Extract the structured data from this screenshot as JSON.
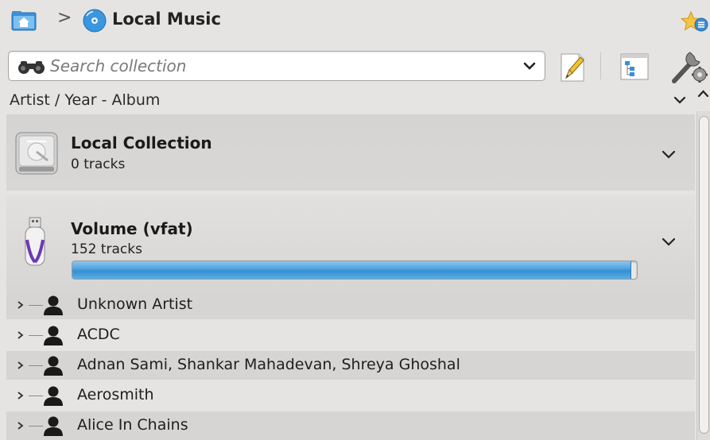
{
  "breadcrumb": {
    "separator": ">",
    "title": "Local Music",
    "home_icon": "folder-home-icon",
    "disc_icon": "music-disc-icon",
    "bookmark_icon": "bookmark-star-icon"
  },
  "search": {
    "placeholder": "Search collection",
    "value": ""
  },
  "toolbar": {
    "edit_icon": "edit-filter-icon",
    "view_icon": "view-mode-icon",
    "tools_icon": "tools-icon"
  },
  "sort": {
    "label": "Artist / Year - Album"
  },
  "collections": [
    {
      "title": "Local Collection",
      "subtitle": "0 tracks",
      "icon": "hard-drive-icon"
    },
    {
      "title": "Volume (vfat)",
      "subtitle": "152 tracks",
      "icon": "usb-drive-icon",
      "capacity_used_percent": 99
    }
  ],
  "artists": [
    "Unknown Artist",
    "ACDC",
    "Adnan Sami, Shankar Mahadevan, Shreya Ghoshal",
    "Aerosmith",
    "Alice In Chains"
  ],
  "colors": {
    "background": "#e6e4e2",
    "progress": "#3590d1",
    "row_alt": "#d7d5d3"
  }
}
